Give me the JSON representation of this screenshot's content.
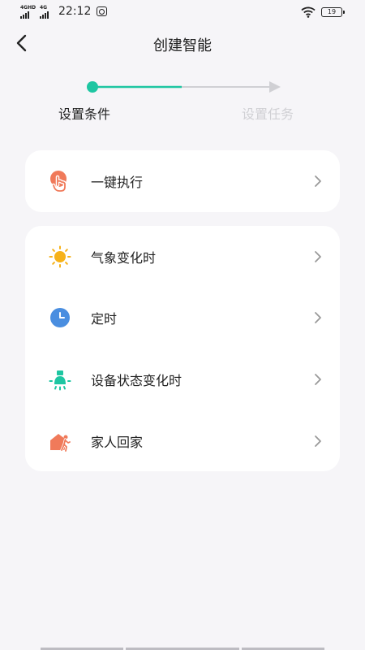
{
  "status_bar": {
    "sim1": "4GHD",
    "sim2": "4G",
    "time": "22:12",
    "battery": "19"
  },
  "header": {
    "title": "创建智能"
  },
  "steps": {
    "current": "设置条件",
    "next": "设置任务",
    "progress": 0.5,
    "active_color": "#1ec6a2",
    "inactive_color": "#d0d0d4"
  },
  "quick_card": {
    "items": [
      {
        "label": "一键执行",
        "icon": "tap-hand-icon"
      }
    ]
  },
  "condition_card": {
    "items": [
      {
        "label": "气象变化时",
        "icon": "sun-icon"
      },
      {
        "label": "定时",
        "icon": "clock-icon"
      },
      {
        "label": "设备状态变化时",
        "icon": "device-bulb-icon"
      },
      {
        "label": "家人回家",
        "icon": "home-person-icon"
      }
    ]
  },
  "colors": {
    "accent": "#1ec6a2",
    "orange": "#f07a5a",
    "sun": "#f6b21a",
    "clock": "#4a8ee0"
  }
}
